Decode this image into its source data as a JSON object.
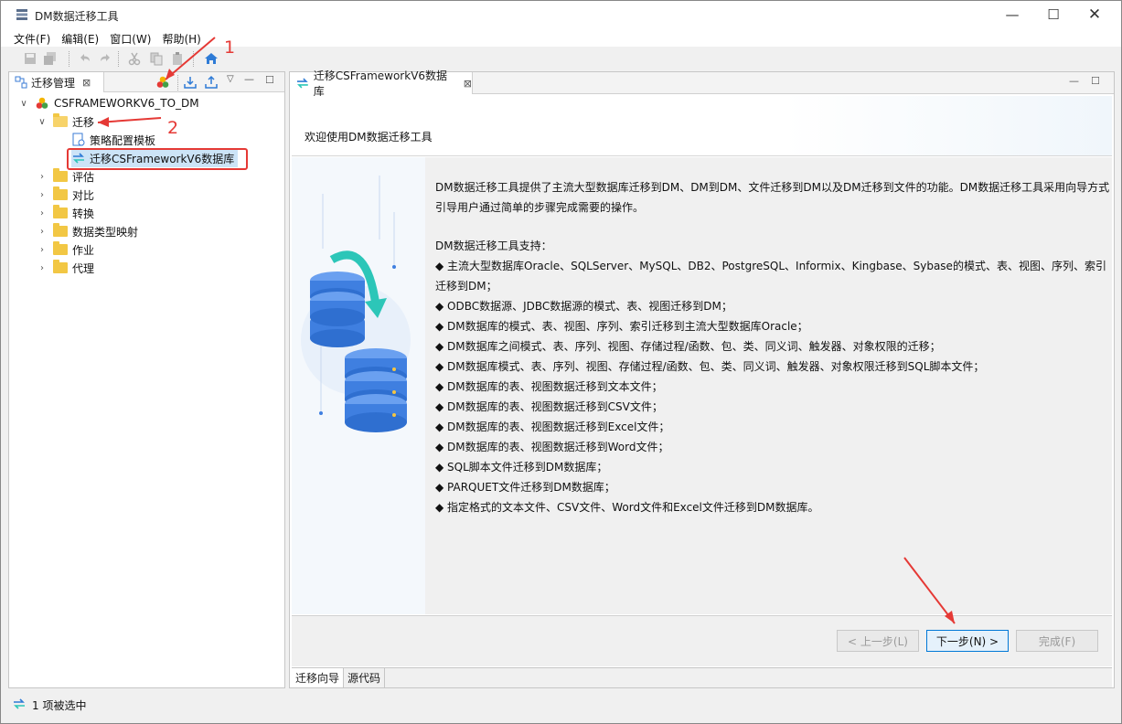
{
  "window": {
    "title": "DM数据迁移工具",
    "minimize": "—",
    "maximize": "☐",
    "close": "✕"
  },
  "menu": [
    "文件(F)",
    "编辑(E)",
    "窗口(W)",
    "帮助(H)"
  ],
  "left_panel": {
    "tab_label": "迁移管理",
    "tab_close": "⊠",
    "tree": {
      "root": "CSFRAMEWORKV6_TO_DM",
      "migration_folder": "迁移",
      "children": [
        "策略配置模板",
        "迁移CSFrameworkV6数据库"
      ],
      "folders": [
        "评估",
        "对比",
        "转换",
        "数据类型映射",
        "作业",
        "代理"
      ]
    }
  },
  "right_panel": {
    "tab_label": "迁移CSFrameworkV6数据库",
    "tab_close": "⊠",
    "wizard_title": "欢迎使用DM数据迁移工具",
    "intro": "DM数据迁移工具提供了主流大型数据库迁移到DM、DM到DM、文件迁移到DM以及DM迁移到文件的功能。DM数据迁移工具采用向导方式引导用户通过简单的步骤完成需要的操作。",
    "support_heading": "DM数据迁移工具支持：",
    "support_items": [
      "◆ 主流大型数据库Oracle、SQLServer、MySQL、DB2、PostgreSQL、Informix、Kingbase、Sybase的模式、表、视图、序列、索引迁移到DM；",
      "◆ ODBC数据源、JDBC数据源的模式、表、视图迁移到DM；",
      "◆ DM数据库的模式、表、视图、序列、索引迁移到主流大型数据库Oracle；",
      "◆ DM数据库之间模式、表、序列、视图、存储过程/函数、包、类、同义词、触发器、对象权限的迁移；",
      "◆ DM数据库模式、表、序列、视图、存储过程/函数、包、类、同义词、触发器、对象权限迁移到SQL脚本文件；",
      "◆ DM数据库的表、视图数据迁移到文本文件；",
      "◆ DM数据库的表、视图数据迁移到CSV文件；",
      "◆ DM数据库的表、视图数据迁移到Excel文件；",
      "◆ DM数据库的表、视图数据迁移到Word文件；",
      "◆ SQL脚本文件迁移到DM数据库；",
      "◆ PARQUET文件迁移到DM数据库；",
      "◆ 指定格式的文本文件、CSV文件、Word文件和Excel文件迁移到DM数据库。"
    ],
    "buttons": {
      "back": "< 上一步(L)",
      "next": "下一步(N) >",
      "finish": "完成(F)"
    },
    "bottom_tabs": [
      "迁移向导",
      "源代码"
    ]
  },
  "status": "1 项被选中",
  "annotations": [
    "1",
    "2"
  ],
  "colors": {
    "accent": "#0078d7",
    "annotation_red": "#e53935",
    "folder_yellow": "#f2c744",
    "db_blue": "#3f7fe0",
    "arrow_teal": "#2cc6b8"
  }
}
